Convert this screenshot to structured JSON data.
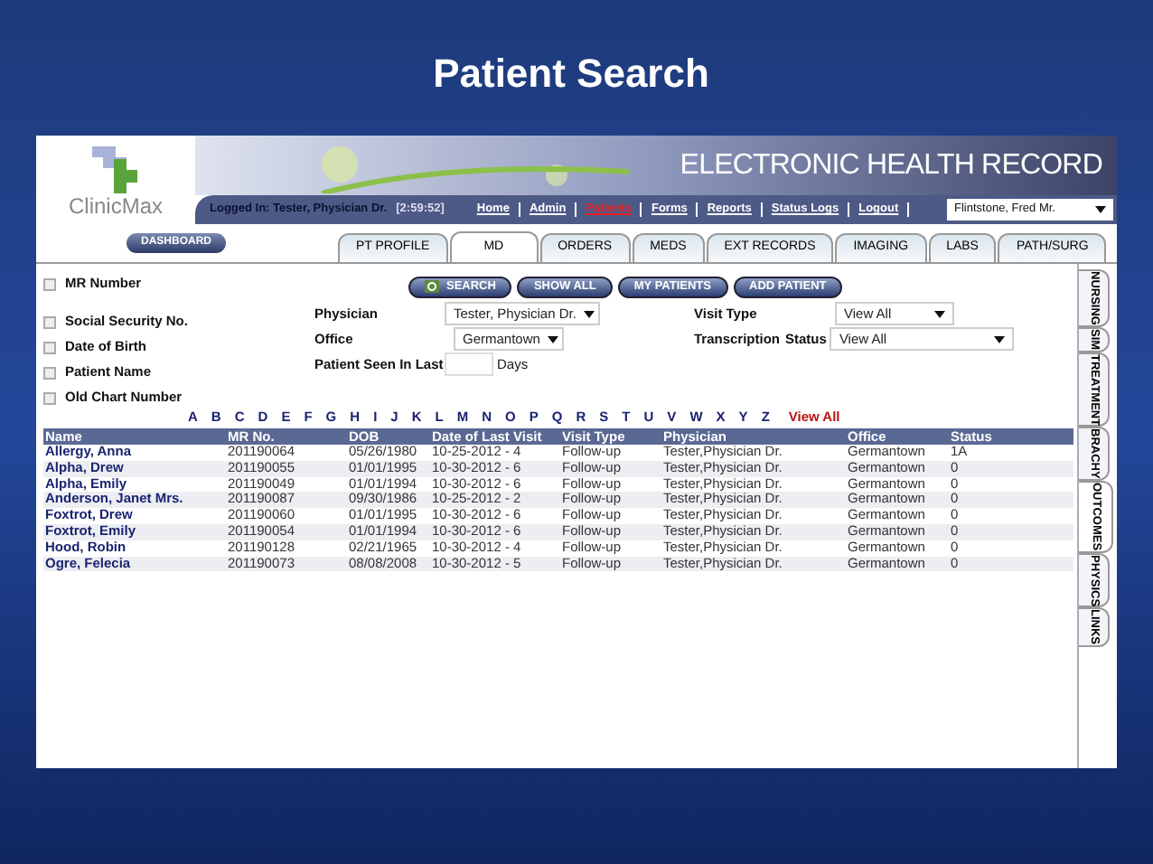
{
  "slide_title": "Patient Search",
  "brand": {
    "logo_text": "ClinicMax",
    "banner_title": "ELECTRONIC HEALTH RECORD"
  },
  "nav": {
    "logged_in": "Logged In: Tester, Physician Dr.",
    "timer": "[2:59:52]",
    "links": [
      {
        "label": "Home",
        "selected": false
      },
      {
        "label": "Admin",
        "selected": false
      },
      {
        "label": "Patients",
        "selected": true
      },
      {
        "label": "Forms",
        "selected": false
      },
      {
        "label": "Reports",
        "selected": false
      },
      {
        "label": "Status Logs",
        "selected": false
      },
      {
        "label": "Logout",
        "selected": false
      }
    ],
    "patient_select": "Flintstone, Fred Mr."
  },
  "dashboard_button": "DASHBOARD",
  "tabs": [
    {
      "label": "PT PROFILE",
      "selected": false
    },
    {
      "label": "MD",
      "selected": true
    },
    {
      "label": "ORDERS",
      "selected": false
    },
    {
      "label": "MEDS",
      "selected": false
    },
    {
      "label": "EXT RECORDS",
      "selected": false
    },
    {
      "label": "IMAGING",
      "selected": false
    },
    {
      "label": "LABS",
      "selected": false
    },
    {
      "label": "PATH/SURG",
      "selected": false
    }
  ],
  "side_tabs": [
    {
      "label": "NURSING",
      "selected": false
    },
    {
      "label": "SIM",
      "selected": false
    },
    {
      "label": "TREATMENT",
      "selected": false
    },
    {
      "label": "BRACHY",
      "selected": false
    },
    {
      "label": "OUTCOMES",
      "selected": true
    },
    {
      "label": "PHYSICS",
      "selected": false
    },
    {
      "label": "LINKS",
      "selected": false
    }
  ],
  "search_options": [
    {
      "label": "MR Number",
      "checked": false
    },
    {
      "label": "Social Security No.",
      "checked": false
    },
    {
      "label": "Date of Birth",
      "checked": false
    },
    {
      "label": "Patient Name",
      "checked": false
    },
    {
      "label": "Old Chart Number",
      "checked": false
    }
  ],
  "action_buttons": [
    "SEARCH",
    "SHOW ALL",
    "MY PATIENTS",
    "ADD PATIENT"
  ],
  "filters": {
    "physician_label": "Physician",
    "physician": "Tester, Physician Dr.",
    "office_label": "Office",
    "office": "Germantown",
    "seen_label": "Patient Seen In Last",
    "seen_unit": "Days",
    "visit_type_label": "Visit Type",
    "visit_type": "View All",
    "transcription_label": "Transcription",
    "status_label": "Status",
    "status": "View All"
  },
  "letters": [
    "A",
    "B",
    "C",
    "D",
    "E",
    "F",
    "G",
    "H",
    "I",
    "J",
    "K",
    "L",
    "M",
    "N",
    "O",
    "P",
    "Q",
    "R",
    "S",
    "T",
    "U",
    "V",
    "W",
    "X",
    "Y",
    "Z"
  ],
  "view_all": "View All",
  "table": {
    "columns": [
      "Name",
      "MR No.",
      "DOB",
      "Date of Last Visit",
      "Visit Type",
      "Physician",
      "Office",
      "Status"
    ],
    "rows": [
      [
        "Allergy, Anna",
        "201190064",
        "05/26/1980",
        "10-25-2012 - 4",
        "Follow-up",
        "Tester,Physician Dr.",
        "Germantown",
        "1A"
      ],
      [
        "Alpha, Drew",
        "201190055",
        "01/01/1995",
        "10-30-2012 - 6",
        "Follow-up",
        "Tester,Physician Dr.",
        "Germantown",
        "0"
      ],
      [
        "Alpha, Emily",
        "201190049",
        "01/01/1994",
        "10-30-2012 - 6",
        "Follow-up",
        "Tester,Physician Dr.",
        "Germantown",
        "0"
      ],
      [
        "Anderson, Janet Mrs.",
        "201190087",
        "09/30/1986",
        "10-25-2012 - 2",
        "Follow-up",
        "Tester,Physician Dr.",
        "Germantown",
        "0"
      ],
      [
        "Foxtrot, Drew",
        "201190060",
        "01/01/1995",
        "10-30-2012 - 6",
        "Follow-up",
        "Tester,Physician Dr.",
        "Germantown",
        "0"
      ],
      [
        "Foxtrot, Emily",
        "201190054",
        "01/01/1994",
        "10-30-2012 - 6",
        "Follow-up",
        "Tester,Physician Dr.",
        "Germantown",
        "0"
      ],
      [
        "Hood, Robin",
        "201190128",
        "02/21/1965",
        "10-30-2012 - 4",
        "Follow-up",
        "Tester,Physician Dr.",
        "Germantown",
        "0"
      ],
      [
        "Ogre, Felecia",
        "201190073",
        "08/08/2008",
        "10-30-2012 - 5",
        "Follow-up",
        "Tester,Physician Dr.",
        "Germantown",
        "0"
      ]
    ]
  }
}
